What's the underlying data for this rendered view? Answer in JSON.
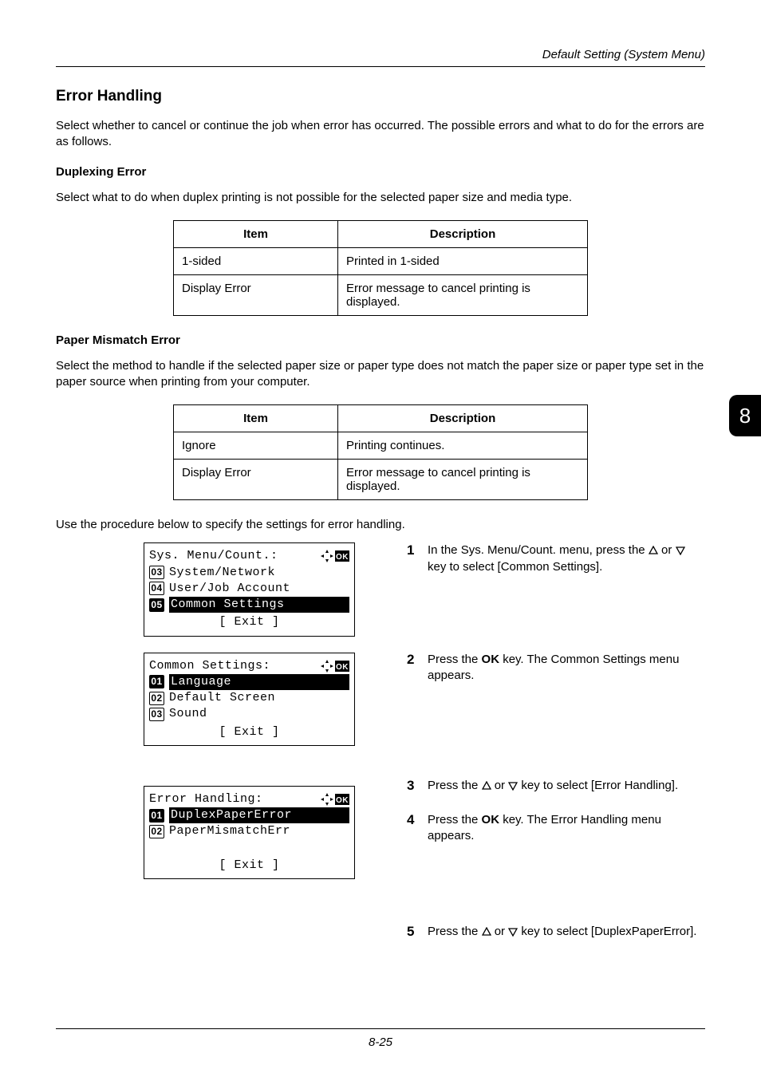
{
  "header": {
    "section_path": "Default Setting (System Menu)"
  },
  "chapter_tab": "8",
  "section_title": "Error Handling",
  "intro_para": "Select whether to cancel or continue the job when error has occurred. The possible errors and what to do for the errors are as follows.",
  "duplexing": {
    "heading": "Duplexing Error",
    "para": "Select what to do when duplex printing is not possible for the selected paper size and media type.",
    "th1": "Item",
    "th2": "Description",
    "r1c1": "1-sided",
    "r1c2": "Printed in 1-sided",
    "r2c1": "Display Error",
    "r2c2": "Error message to cancel printing is displayed."
  },
  "mismatch": {
    "heading": "Paper Mismatch Error",
    "para": "Select the method to handle if the selected paper size or paper type does not match the paper size or paper type set in the paper source when printing from your computer.",
    "th1": "Item",
    "th2": "Description",
    "r1c1": "Ignore",
    "r1c2": "Printing continues.",
    "r2c1": "Display Error",
    "r2c2": "Error message to cancel printing is displayed."
  },
  "procedure_intro": "Use the procedure below to specify the settings for error handling.",
  "lcd1": {
    "title": "Sys. Menu/Count.:",
    "i3_num": "03",
    "i3": "System/Network",
    "i4_num": "04",
    "i4": "User/Job Account",
    "i5_num": "05",
    "i5": "Common Settings",
    "footer": "[  Exit   ]"
  },
  "lcd2": {
    "title": "Common Settings:",
    "i1_num": "01",
    "i1": "Language",
    "i2_num": "02",
    "i2": "Default Screen",
    "i3_num": "03",
    "i3": "Sound",
    "footer": "[  Exit   ]"
  },
  "lcd3": {
    "title": "Error Handling:",
    "i1_num": "01",
    "i1": "DuplexPaperError",
    "i2_num": "02",
    "i2": "PaperMismatchErr",
    "footer": "[  Exit   ]"
  },
  "steps": {
    "s1_pre": "In the Sys. Menu/Count. menu, press the ",
    "s1_mid": " or ",
    "s1_post": " key to select [Common Settings].",
    "s2_pre": "Press the ",
    "s2_bold": "OK",
    "s2_post": " key. The Common Settings menu appears.",
    "s3_pre": "Press the ",
    "s3_mid": " or ",
    "s3_post": " key to select [Error Handling].",
    "s4_pre": "Press the ",
    "s4_bold": "OK",
    "s4_post": " key. The Error Handling menu appears.",
    "s5_pre": "Press the ",
    "s5_mid": " or ",
    "s5_post": " key to select [DuplexPaperError]."
  },
  "page_number": "8-25"
}
